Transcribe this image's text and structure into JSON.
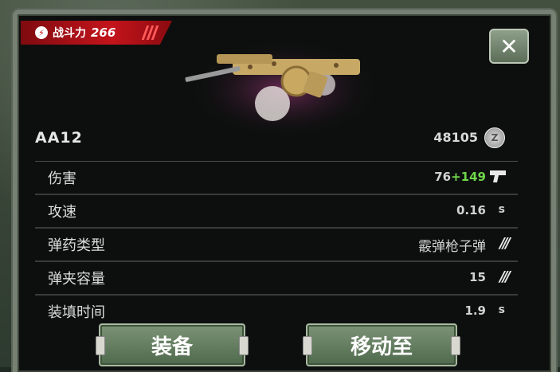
{
  "combat_power": {
    "label": "战斗力",
    "value": "266"
  },
  "weapon": {
    "name": "AA12",
    "price": "48105",
    "coin_symbol": "Z"
  },
  "stats": [
    {
      "label": "伤害",
      "value": "76",
      "bonus": "+149",
      "icon": "pistol-icon"
    },
    {
      "label": "攻速",
      "value": "0.16",
      "unit": "s"
    },
    {
      "label": "弹药类型",
      "value": "霰弹枪子弹",
      "icon": "ammo-icon"
    },
    {
      "label": "弹夹容量",
      "value": "15",
      "icon": "ammo-icon"
    },
    {
      "label": "装填时间",
      "value": "1.9",
      "unit": "s"
    }
  ],
  "buttons": {
    "equip": "装备",
    "move_to": "移动至"
  },
  "colors": {
    "badge_red": "#c4141b",
    "bonus_green": "#6fd64a",
    "button_green": "#6a8363"
  }
}
